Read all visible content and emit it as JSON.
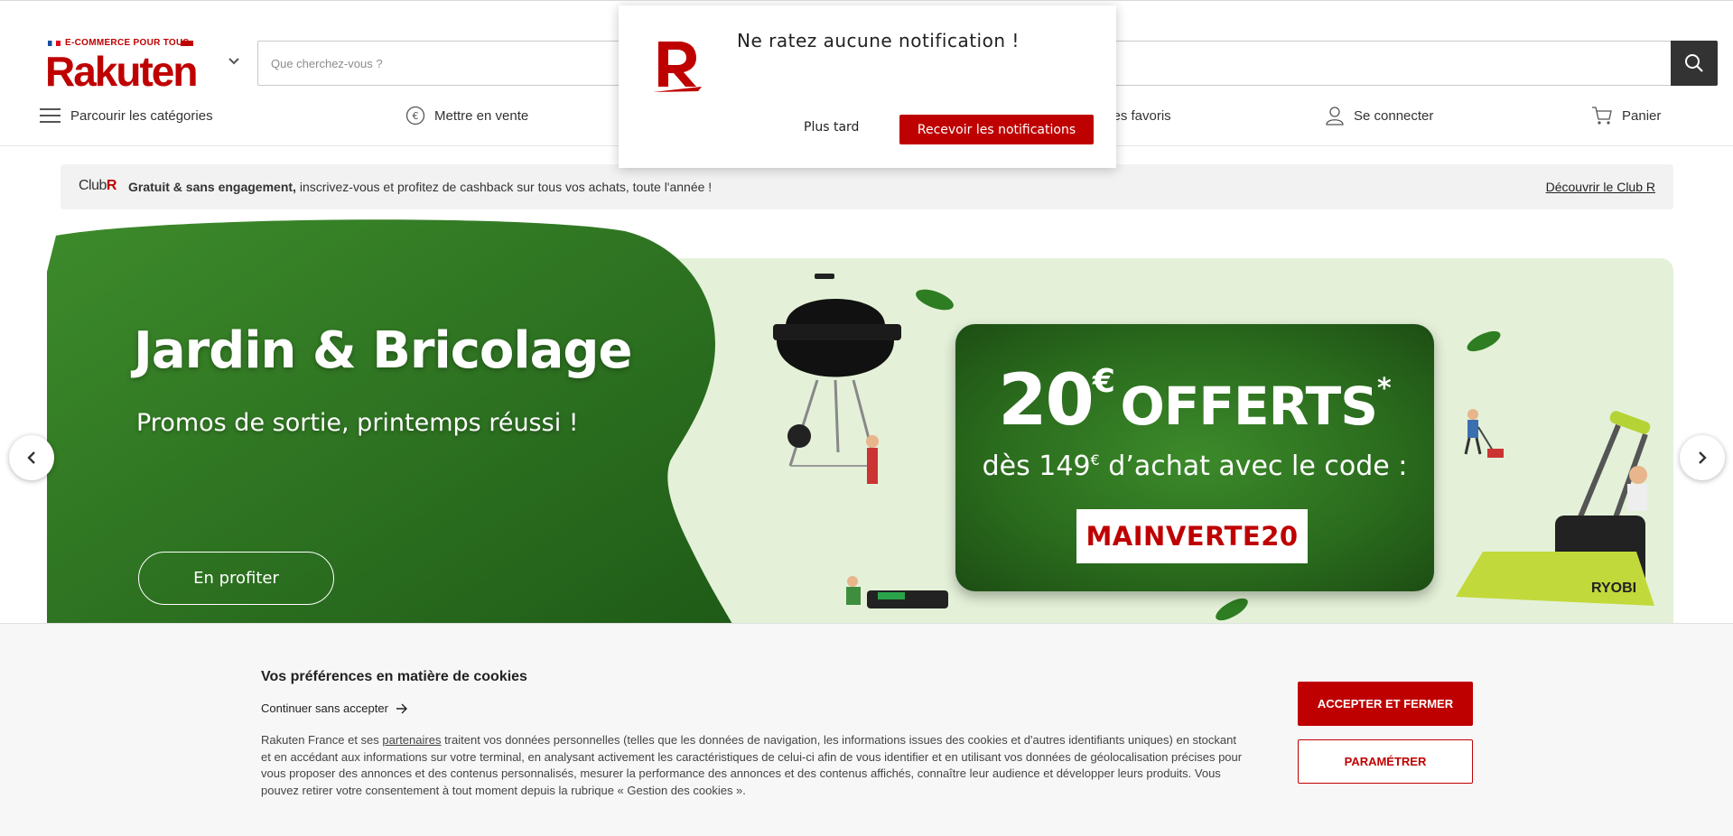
{
  "header": {
    "logo_tagline": "E-COMMERCE POUR TOUS",
    "logo_text": "Rakuten",
    "search_placeholder": "Que cherchez-vous ?",
    "nav": {
      "categories": "Parcourir les catégories",
      "sell": "Mettre en vente",
      "favorites": "Mes favoris",
      "login": "Se connecter",
      "cart": "Panier"
    }
  },
  "notification_popup": {
    "message": "Ne ratez aucune notification !",
    "later_label": "Plus tard",
    "accept_label": "Recevoir les notifications"
  },
  "club_banner": {
    "logo_text": "Club",
    "logo_r": "R",
    "bold_text": "Gratuit & sans engagement,",
    "text": " inscrivez-vous et profitez de cashback sur tous vos achats, toute l'année !",
    "link": "Découvrir le Club R"
  },
  "hero": {
    "title": "Jardin & Bricolage",
    "subtitle": "Promos de sortie, printemps réussi !",
    "button": "En profiter",
    "promo_amount": "20",
    "promo_currency": "€",
    "promo_offer": "OFFERTS",
    "promo_star": "*",
    "promo_condition_prefix": "dès 149",
    "promo_condition_currency": "€",
    "promo_condition_suffix": " d’achat avec le code :",
    "promo_code": "MAINVERTE20",
    "mower_brand": "RYOBI"
  },
  "cookie_banner": {
    "title": "Vos préférences en matière de cookies",
    "continue_label": "Continuer sans accepter",
    "body_prefix": "Rakuten France et ses ",
    "body_link": "partenaires",
    "body_suffix": " traitent vos données personnelles (telles que les données de navigation, les informations issues des cookies et d'autres identifiants uniques) en stockant et en accédant aux informations sur votre terminal, en analysant activement les caractéristiques de celui-ci afin de vous identifier et en utilisant vos données de géolocalisation précises pour vous proposer des annonces et des contenus personnalisés, mesurer la performance des annonces et des contenus affichés, connaître leur audience et développer leurs produits. Vous pouvez retirer votre consentement à tout moment depuis la rubrique « Gestion des cookies ».",
    "accept_button": "ACCEPTER ET FERMER",
    "settings_button": "PARAMÉTRER"
  },
  "colors": {
    "brand_red": "#bf0000",
    "dark": "#333333",
    "promo_bg": "#e4f1d8"
  }
}
